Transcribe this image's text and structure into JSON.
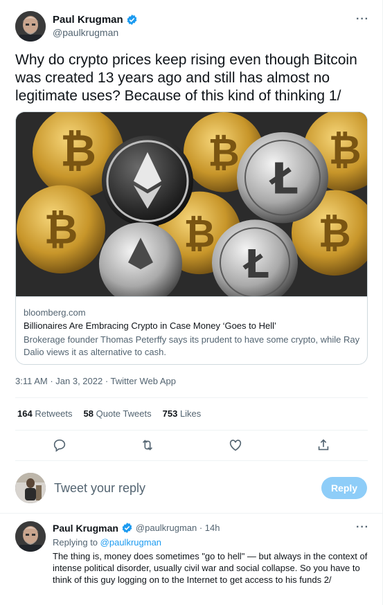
{
  "tweet": {
    "author_name": "Paul Krugman",
    "author_handle": "@paulkrugman",
    "more_icon": "more-icon",
    "text": "Why do crypto prices keep rising even though Bitcoin was created 13 years ago and still has almost no legitimate uses? Because of this kind of thinking 1/",
    "card": {
      "image": "crypto-coins-image",
      "domain": "bloomberg.com",
      "title": "Billionaires Are Embracing Crypto in Case Money ‘Goes to Hell’",
      "description": "Brokerage founder Thomas Peterffy says its prudent to have some crypto, while Ray Dalio views it as alternative to cash."
    },
    "meta": "3:11 AM · Jan 3, 2022 · Twitter Web App",
    "stats": {
      "retweets_count": "164",
      "retweets_label": "Retweets",
      "quotes_count": "58",
      "quotes_label": "Quote Tweets",
      "likes_count": "753",
      "likes_label": "Likes"
    },
    "actions": [
      "reply-icon",
      "retweet-icon",
      "like-icon",
      "share-icon"
    ]
  },
  "composer": {
    "placeholder": "Tweet your reply",
    "button_label": "Reply"
  },
  "reply": {
    "author_name": "Paul Krugman",
    "handle_time": "@paulkrugman · 14h",
    "replying_to_label": "Replying to",
    "replying_to_handle": "@paulkrugman",
    "text": "The thing is, money does sometimes \"go to hell\" — but always in the context of intense political disorder, usually civil war and social collapse. So you have to think of this guy logging on to the Internet to get access to his funds 2/"
  },
  "colors": {
    "accent": "#1d9bf0",
    "reply_button_disabled": "#8ecdf8",
    "secondary_text": "#536471",
    "primary_text": "#0f1419",
    "border": "#cfd9de"
  }
}
